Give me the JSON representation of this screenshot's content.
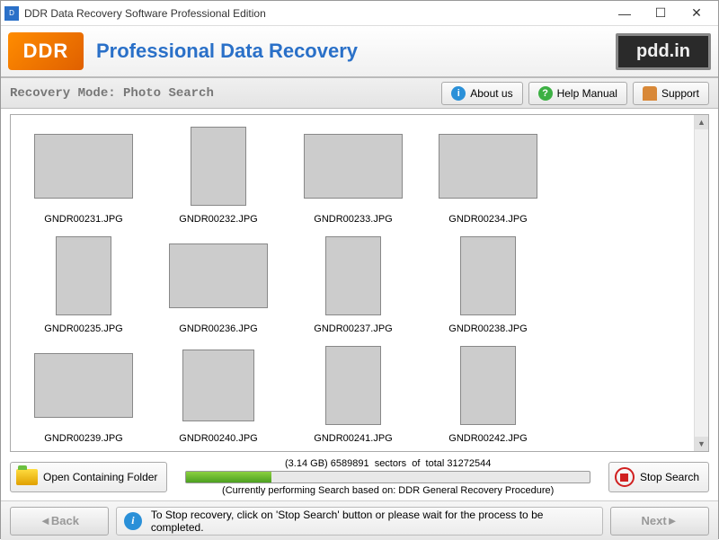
{
  "window": {
    "title": "DDR Data Recovery Software Professional Edition"
  },
  "header": {
    "logo_text": "DDR",
    "heading": "Professional Data Recovery",
    "brand_pill": "pdd.in"
  },
  "modebar": {
    "label": "Recovery Mode:",
    "value": "Photo Search",
    "buttons": {
      "about": "About us",
      "help": "Help Manual",
      "support": "Support"
    }
  },
  "gallery": {
    "items": [
      {
        "filename": "GNDR00231.JPG",
        "shape": "landscape",
        "cls": "img0"
      },
      {
        "filename": "GNDR00232.JPG",
        "shape": "portrait",
        "cls": "img1"
      },
      {
        "filename": "GNDR00233.JPG",
        "shape": "landscape",
        "cls": "img2"
      },
      {
        "filename": "GNDR00234.JPG",
        "shape": "landscape",
        "cls": "img3"
      },
      {
        "filename": "GNDR00235.JPG",
        "shape": "portrait",
        "cls": "img4"
      },
      {
        "filename": "GNDR00236.JPG",
        "shape": "landscape",
        "cls": "img5"
      },
      {
        "filename": "GNDR00237.JPG",
        "shape": "portrait",
        "cls": "img6"
      },
      {
        "filename": "GNDR00238.JPG",
        "shape": "portrait",
        "cls": "img7"
      },
      {
        "filename": "GNDR00239.JPG",
        "shape": "landscape",
        "cls": "img8"
      },
      {
        "filename": "GNDR00240.JPG",
        "shape": "square",
        "cls": "img9"
      },
      {
        "filename": "GNDR00241.JPG",
        "shape": "portrait",
        "cls": "img10"
      },
      {
        "filename": "GNDR00242.JPG",
        "shape": "portrait",
        "cls": "img11"
      }
    ]
  },
  "progress": {
    "open_folder_label": "Open Containing Folder",
    "stats": "(3.14 GB) 6589891  sectors  of  total 31272544",
    "note": "(Currently performing Search based on:  DDR General Recovery Procedure)",
    "stop_label": "Stop Search",
    "percent": 21
  },
  "footer": {
    "back": "Back",
    "next": "Next",
    "message": "To Stop recovery, click on 'Stop Search' button or please wait for the process to be completed."
  }
}
